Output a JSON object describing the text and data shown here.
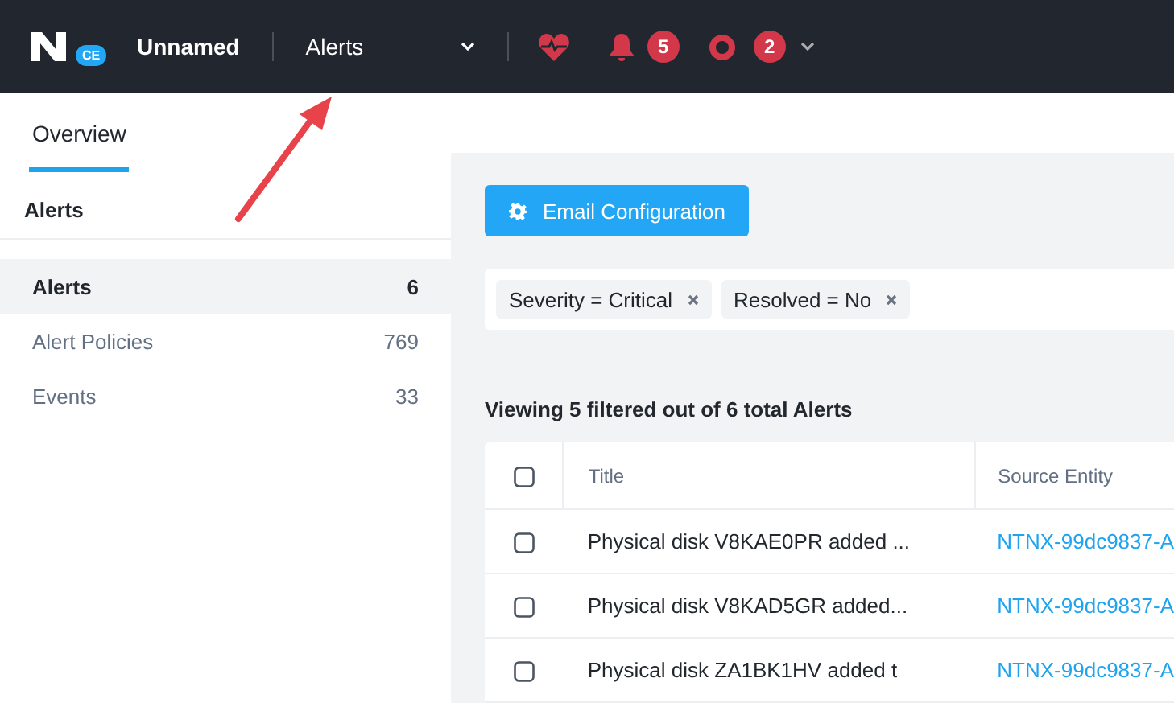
{
  "header": {
    "logo_badge": "CE",
    "cluster": "Unnamed",
    "page": "Alerts",
    "alert_count": "5",
    "event_count": "2"
  },
  "tabs": [
    {
      "label": "Overview",
      "selected": true
    }
  ],
  "sidebar": {
    "title": "Alerts",
    "items": [
      {
        "label": "Alerts",
        "count": "6",
        "selected": true
      },
      {
        "label": "Alert Policies",
        "count": "769",
        "selected": false
      },
      {
        "label": "Events",
        "count": "33",
        "selected": false
      }
    ]
  },
  "email_button": "Email Configuration",
  "filters": [
    {
      "label": "Severity = Critical"
    },
    {
      "label": "Resolved = No"
    }
  ],
  "summary": "Viewing 5 filtered out of 6 total Alerts",
  "table": {
    "columns": [
      "Title",
      "Source Entity"
    ],
    "select_all_checked": false,
    "rows": [
      {
        "title": "Physical disk V8KAE0PR added ...",
        "source": "NTNX-99dc9837-A",
        "checked": false
      },
      {
        "title": "Physical disk V8KAD5GR added...",
        "source": "NTNX-99dc9837-A",
        "checked": false
      },
      {
        "title": "Physical disk ZA1BK1HV added t",
        "source": "NTNX-99dc9837-A",
        "checked": false
      }
    ]
  }
}
